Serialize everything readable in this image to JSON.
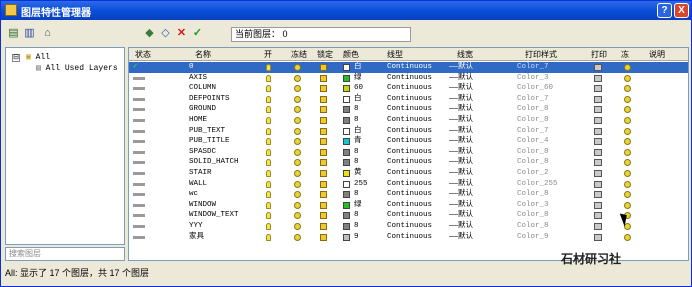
{
  "window": {
    "title": "图层特性管理器",
    "help_label": "?",
    "close_label": "X"
  },
  "toolbar": {
    "current_layer_label": "当前图层：",
    "current_layer_value": "0"
  },
  "tree": {
    "root_label": "All",
    "child_label": "All Used Layers",
    "expander": "⊟"
  },
  "filter_search_placeholder": "搜索图层",
  "grid": {
    "columns": [
      "状态",
      "名称",
      "开",
      "冻结",
      "锁定",
      "颜色",
      "线型",
      "线宽",
      "打印样式",
      "打印",
      "冻",
      "说明"
    ],
    "rows": [
      {
        "name": "0",
        "color_name": "白",
        "color_hex": "#ffffff",
        "linetype": "Continuous",
        "lineweight": "——默认",
        "plotstyle": "Color_7",
        "selected": true
      },
      {
        "name": "AXIS",
        "color_name": "绿",
        "color_hex": "#22c022",
        "linetype": "Continuous",
        "lineweight": "——默认",
        "plotstyle": "Color_3"
      },
      {
        "name": "COLUMN",
        "color_name": "60",
        "color_hex": "#c8d810",
        "linetype": "Continuous",
        "lineweight": "——默认",
        "plotstyle": "Color_60"
      },
      {
        "name": "DEFPOINTS",
        "color_name": "白",
        "color_hex": "#ffffff",
        "linetype": "Continuous",
        "lineweight": "——默认",
        "plotstyle": "Color_7"
      },
      {
        "name": "GROUND",
        "color_name": "8",
        "color_hex": "#808080",
        "linetype": "Continuous",
        "lineweight": "——默认",
        "plotstyle": "Color_8"
      },
      {
        "name": "HOME",
        "color_name": "8",
        "color_hex": "#808080",
        "linetype": "Continuous",
        "lineweight": "——默认",
        "plotstyle": "Color_8"
      },
      {
        "name": "PUB_TEXT",
        "color_name": "白",
        "color_hex": "#ffffff",
        "linetype": "Continuous",
        "lineweight": "——默认",
        "plotstyle": "Color_7"
      },
      {
        "name": "PUB_TITLE",
        "color_name": "青",
        "color_hex": "#10c8d0",
        "linetype": "Continuous",
        "lineweight": "——默认",
        "plotstyle": "Color_4"
      },
      {
        "name": "SPASDC",
        "color_name": "8",
        "color_hex": "#808080",
        "linetype": "Continuous",
        "lineweight": "——默认",
        "plotstyle": "Color_8"
      },
      {
        "name": "SOLID_HATCH",
        "color_name": "8",
        "color_hex": "#808080",
        "linetype": "Continuous",
        "lineweight": "——默认",
        "plotstyle": "Color_8"
      },
      {
        "name": "STAIR",
        "color_name": "黄",
        "color_hex": "#e8e010",
        "linetype": "Continuous",
        "lineweight": "——默认",
        "plotstyle": "Color_2"
      },
      {
        "name": "WALL",
        "color_name": "255",
        "color_hex": "#ffffff",
        "linetype": "Continuous",
        "lineweight": "——默认",
        "plotstyle": "Color_255"
      },
      {
        "name": "wc",
        "color_name": "8",
        "color_hex": "#808080",
        "linetype": "Continuous",
        "lineweight": "——默认",
        "plotstyle": "Color_8"
      },
      {
        "name": "WINDOW",
        "color_name": "绿",
        "color_hex": "#22c022",
        "linetype": "Continuous",
        "lineweight": "——默认",
        "plotstyle": "Color_3"
      },
      {
        "name": "WINDOW_TEXT",
        "color_name": "8",
        "color_hex": "#808080",
        "linetype": "Continuous",
        "lineweight": "——默认",
        "plotstyle": "Color_8"
      },
      {
        "name": "YYY",
        "color_name": "8",
        "color_hex": "#808080",
        "linetype": "Continuous",
        "lineweight": "——默认",
        "plotstyle": "Color_8"
      },
      {
        "name": "家具",
        "color_name": "9",
        "color_hex": "#c0c0c0",
        "linetype": "Continuous",
        "lineweight": "——默认",
        "plotstyle": "Color_9"
      }
    ]
  },
  "status_text": "All: 显示了 17 个图层，共 17 个图层",
  "watermark": "石材研习社"
}
